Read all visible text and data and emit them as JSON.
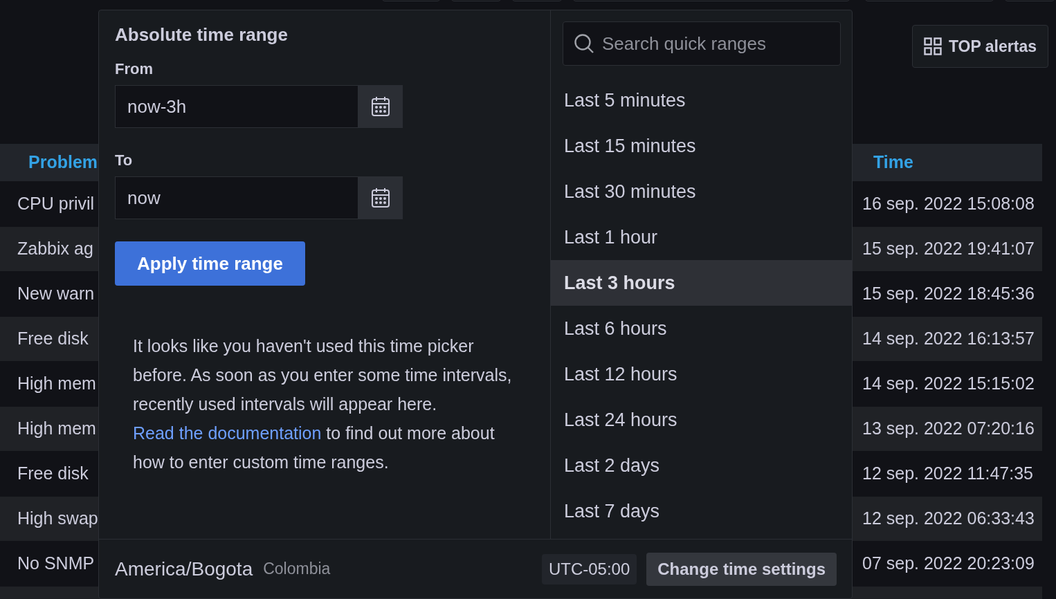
{
  "toolbar": {
    "button": "TOP alertas"
  },
  "table": {
    "columns": [
      "Problem",
      "Time"
    ],
    "rows": [
      {
        "problem": "CPU privil",
        "time": "16 sep. 2022 15:08:08"
      },
      {
        "problem": "Zabbix ag",
        "time": "15 sep. 2022 19:41:07"
      },
      {
        "problem": "New warn",
        "time": "15 sep. 2022 18:45:36"
      },
      {
        "problem": "Free disk",
        "time": "14 sep. 2022 16:13:57"
      },
      {
        "problem": "High mem",
        "time": "14 sep. 2022 15:15:02"
      },
      {
        "problem": "High mem",
        "time": "13 sep. 2022 07:20:16"
      },
      {
        "problem": "Free disk",
        "time": "12 sep. 2022 11:47:35"
      },
      {
        "problem": "High swap",
        "time": "12 sep. 2022 06:33:43"
      },
      {
        "problem": "No SNMP",
        "time": "07 sep. 2022 20:23:09"
      }
    ]
  },
  "time_picker": {
    "title": "Absolute time range",
    "from": {
      "label": "From",
      "value": "now-3h"
    },
    "to": {
      "label": "To",
      "value": "now"
    },
    "apply_button": "Apply time range",
    "help": {
      "text": "It looks like you haven't used this time picker before. As soon as you enter some time intervals, recently used intervals will appear here.",
      "link": "Read the documentation",
      "text_after": " to find out more about how to enter custom time ranges."
    },
    "search": {
      "placeholder": "Search quick ranges"
    },
    "quick_ranges": [
      {
        "label": "Last 5 minutes",
        "selected": false
      },
      {
        "label": "Last 15 minutes",
        "selected": false
      },
      {
        "label": "Last 30 minutes",
        "selected": false
      },
      {
        "label": "Last 1 hour",
        "selected": false
      },
      {
        "label": "Last 3 hours",
        "selected": true
      },
      {
        "label": "Last 6 hours",
        "selected": false
      },
      {
        "label": "Last 12 hours",
        "selected": false
      },
      {
        "label": "Last 24 hours",
        "selected": false
      },
      {
        "label": "Last 2 days",
        "selected": false
      },
      {
        "label": "Last 7 days",
        "selected": false
      }
    ],
    "footer": {
      "timezone": "America/Bogota",
      "country": "Colombia",
      "offset": "UTC-05:00",
      "settings_button": "Change time settings"
    }
  }
}
